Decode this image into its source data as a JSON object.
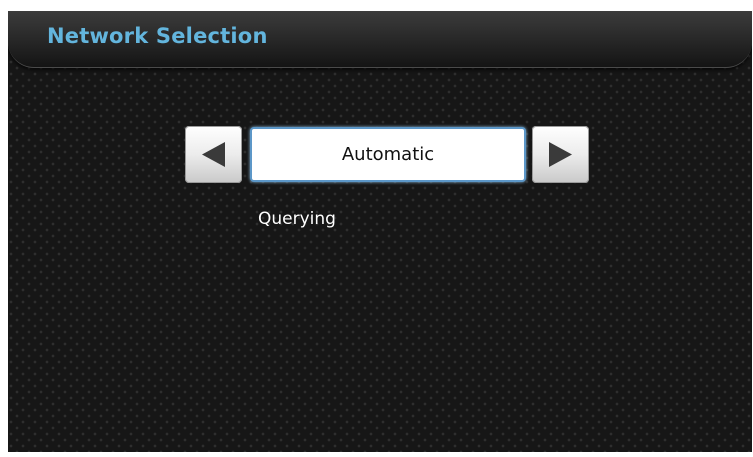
{
  "header": {
    "title": "Network Selection"
  },
  "selector": {
    "value": "Automatic",
    "prev_icon": "triangle-left-icon",
    "next_icon": "triangle-right-icon"
  },
  "status": {
    "text": "Querying"
  },
  "colors": {
    "title": "#63b5dd",
    "background": "#161616",
    "focus_border": "#5c97c8"
  }
}
